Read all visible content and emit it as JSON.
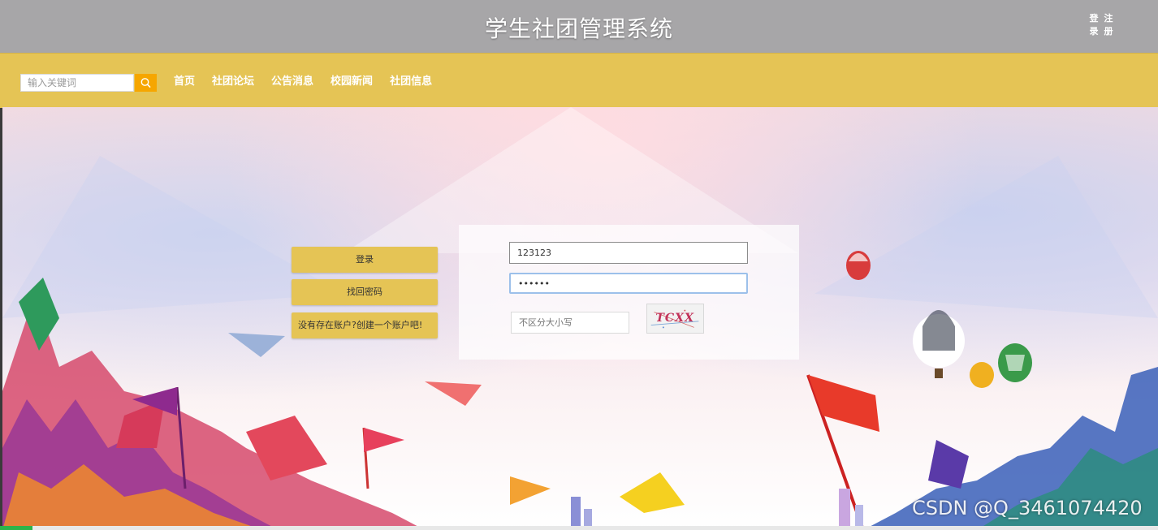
{
  "header": {
    "title": "学生社团管理系统",
    "login_link": "登录",
    "register_link": "注册"
  },
  "navbar": {
    "search": {
      "placeholder": "输入关键词",
      "icon": "search-icon"
    },
    "menu": [
      "首页",
      "社团论坛",
      "公告消息",
      "校园新闻",
      "社团信息"
    ]
  },
  "side_buttons": {
    "login": "登录",
    "recover_password": "找回密码",
    "create_account": "没有存在账户?创建一个账户吧!"
  },
  "login_form": {
    "username_value": "123123",
    "password_value": "123456",
    "captcha_placeholder": "不区分大小写",
    "captcha_text": "TCXX"
  },
  "watermark": "CSDN @Q_3461074420",
  "colors": {
    "topbar": "#a7a6a8",
    "navbar": "#e5c455",
    "search_button": "#f6a600",
    "side_button": "#e5c455"
  }
}
